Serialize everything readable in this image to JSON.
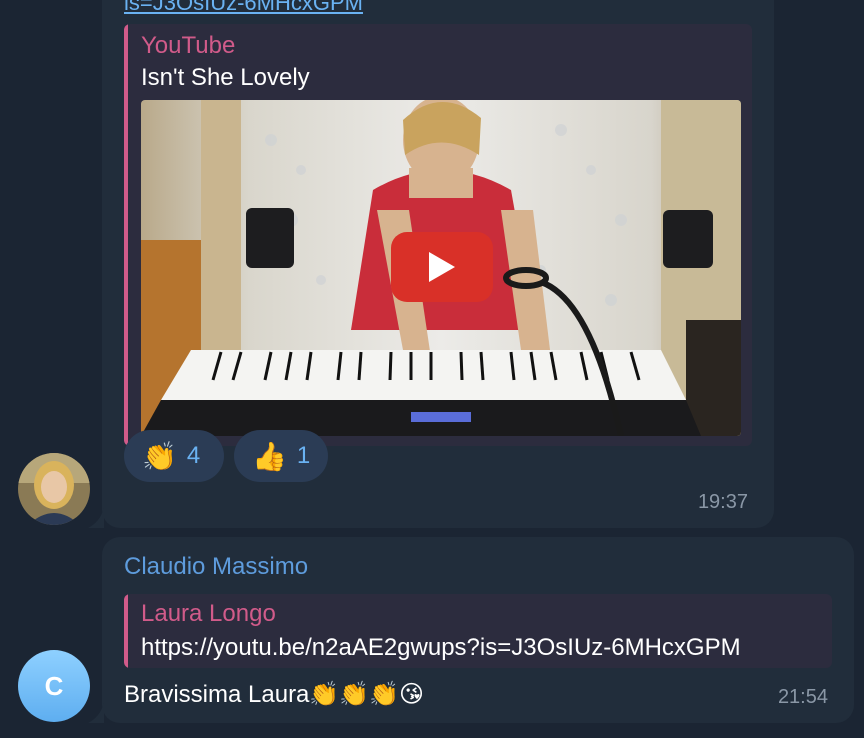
{
  "message1": {
    "link_fragment": "is=J3OsIUz-6MHcxGPM",
    "preview": {
      "site": "YouTube",
      "title": "Isn't She Lovely"
    },
    "reactions": [
      {
        "emoji": "👏",
        "count": "4",
        "icon": "clapping-hands-icon"
      },
      {
        "emoji": "👍",
        "count": "1",
        "icon": "thumbs-up-icon"
      }
    ],
    "time": "19:37"
  },
  "message2": {
    "sender": "Claudio Massimo",
    "avatar_letter": "C",
    "reply": {
      "name": "Laura Longo",
      "text": "https://youtu.be/n2aAE2gwups?is=J3OsIUz-6MHcxGPM"
    },
    "text": "Bravissima Laura👏👏👏😘",
    "time": "21:54"
  },
  "colors": {
    "background": "#1b2533",
    "bubble": "#212d3b",
    "accent_pink": "#d15b8a",
    "link_blue": "#6ab2f2",
    "sender_blue": "#5e9cdd",
    "youtube_red": "#d93028"
  }
}
